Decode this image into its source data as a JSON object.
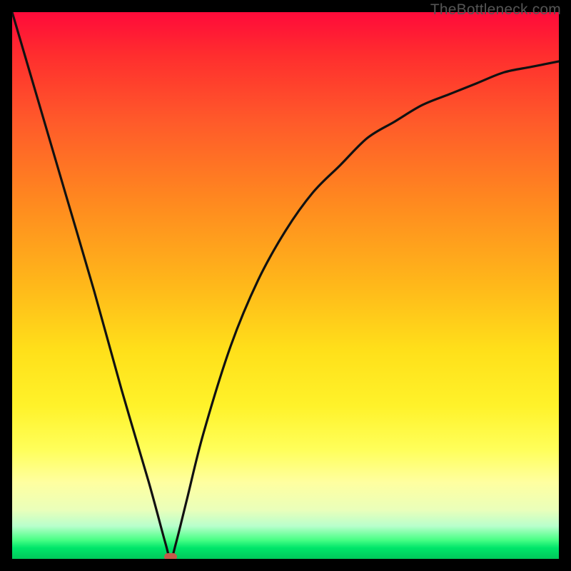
{
  "watermark": {
    "text": "TheBottleneck.com"
  },
  "colors": {
    "frame": "#000000",
    "curve_stroke": "#111111",
    "marker_fill": "#c55a4a"
  },
  "chart_data": {
    "type": "line",
    "title": "",
    "xlabel": "",
    "ylabel": "",
    "xlim": [
      0,
      100
    ],
    "ylim": [
      0,
      100
    ],
    "grid": false,
    "curve": {
      "minimum_x": 29,
      "points": [
        {
          "x": 0,
          "y": 100
        },
        {
          "x": 5,
          "y": 83
        },
        {
          "x": 10,
          "y": 66
        },
        {
          "x": 15,
          "y": 49
        },
        {
          "x": 20,
          "y": 31
        },
        {
          "x": 25,
          "y": 14
        },
        {
          "x": 28,
          "y": 3
        },
        {
          "x": 29,
          "y": 0
        },
        {
          "x": 30,
          "y": 3
        },
        {
          "x": 32,
          "y": 11
        },
        {
          "x": 35,
          "y": 23
        },
        {
          "x": 40,
          "y": 39
        },
        {
          "x": 45,
          "y": 51
        },
        {
          "x": 50,
          "y": 60
        },
        {
          "x": 55,
          "y": 67
        },
        {
          "x": 60,
          "y": 72
        },
        {
          "x": 65,
          "y": 77
        },
        {
          "x": 70,
          "y": 80
        },
        {
          "x": 75,
          "y": 83
        },
        {
          "x": 80,
          "y": 85
        },
        {
          "x": 85,
          "y": 87
        },
        {
          "x": 90,
          "y": 89
        },
        {
          "x": 95,
          "y": 90
        },
        {
          "x": 100,
          "y": 91
        }
      ]
    },
    "marker": {
      "x": 29,
      "y": 0
    }
  }
}
